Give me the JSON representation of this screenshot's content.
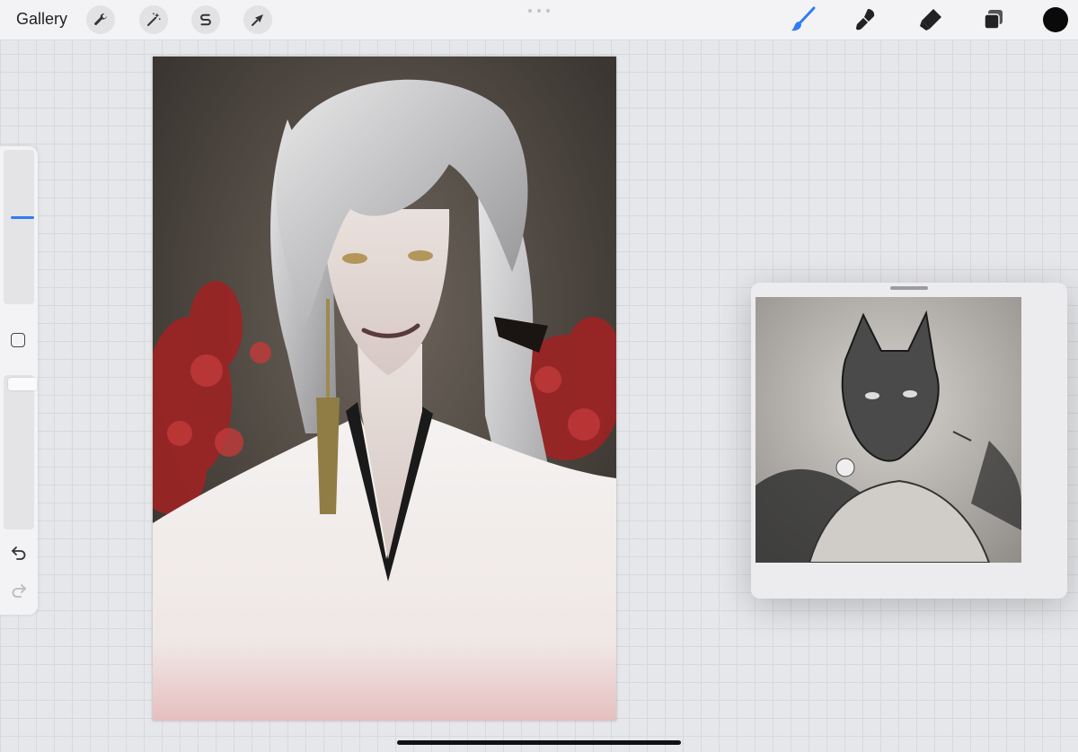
{
  "topbar": {
    "gallery_label": "Gallery",
    "left_tools": [
      "actions-icon",
      "adjustments-icon",
      "selection-icon",
      "transform-icon"
    ],
    "right_tools": [
      "brush-icon",
      "smudge-icon",
      "eraser-icon",
      "layers-icon"
    ],
    "active_tool": "brush-icon",
    "current_color": "#0a0a0a",
    "accent_color": "#2f7cf6"
  },
  "sidebar": {
    "brush_size_fraction": 0.45,
    "brush_opacity_fraction": 0.95,
    "buttons": [
      "modify-icon",
      "undo-icon",
      "redo-icon"
    ]
  },
  "reference_panel": {
    "visible": true
  }
}
